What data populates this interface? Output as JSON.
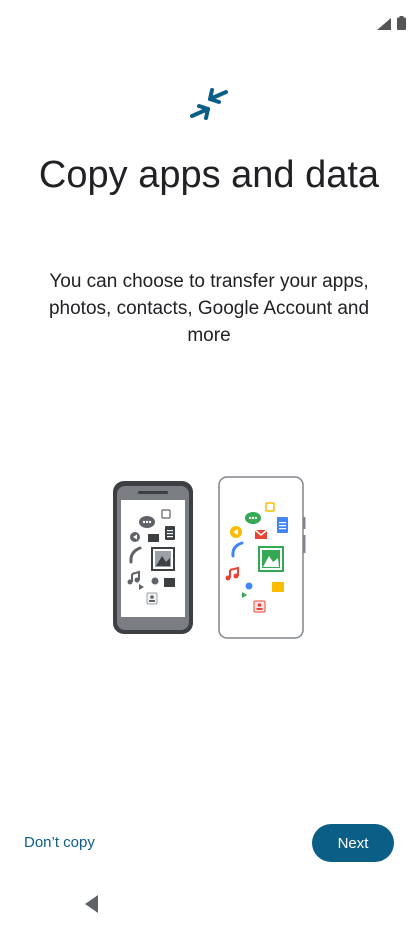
{
  "status_bar": {
    "icons": [
      "cellular-signal-icon",
      "battery-icon"
    ],
    "icon_color": "#555555"
  },
  "header": {
    "icon": "transfer-arrows-icon",
    "icon_color": "#0b5f86",
    "title": "Copy apps and data",
    "description": "You can choose to transfer your apps, photos, contacts, Google Account and more"
  },
  "illustration": {
    "icon": "phone-transfer-illustration",
    "left_device": "old-phone",
    "right_device": "new-phone"
  },
  "actions": {
    "dont_copy_label": "Don’t copy",
    "next_label": "Next",
    "accent_color": "#0b5f86"
  },
  "nav_bar": {
    "back_icon": "back-triangle-icon"
  }
}
